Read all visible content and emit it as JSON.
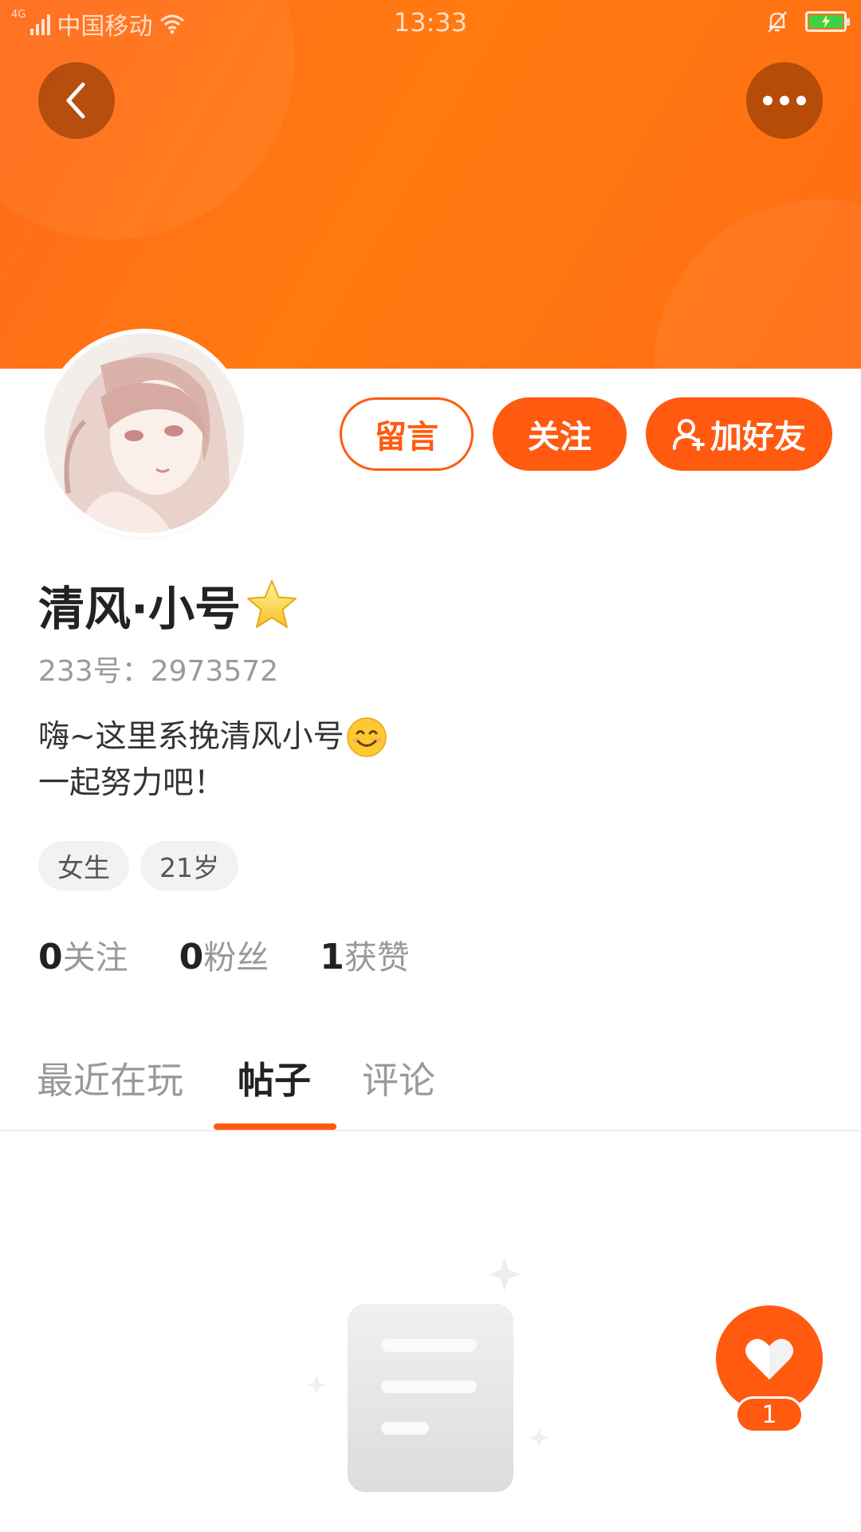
{
  "status_bar": {
    "network": "4G",
    "carrier": "中国移动",
    "time": "13:33",
    "battery_color": "#3bd24a"
  },
  "header": {
    "back_icon": "chevron-left-icon",
    "more_icon": "more-horizontal-icon"
  },
  "actions": {
    "message_label": "留言",
    "follow_label": "关注",
    "add_friend_label": "加好友",
    "accent_color": "#ff5a10"
  },
  "profile": {
    "name": "清风·小号",
    "name_badge_icon": "star-icon",
    "uid_label": "233号：",
    "uid_value": "2973572",
    "bio_line1": "嗨~这里系挽清风小号",
    "bio_emoji_icon": "smile-emoji-icon",
    "bio_line2": "一起努力吧！",
    "tags": [
      "女生",
      "21岁"
    ]
  },
  "stats": [
    {
      "count": "0",
      "label": "关注"
    },
    {
      "count": "0",
      "label": "粉丝"
    },
    {
      "count": "1",
      "label": "获赞"
    }
  ],
  "tabs": {
    "items": [
      "最近在玩",
      "帖子",
      "评论"
    ],
    "active": "帖子"
  },
  "like": {
    "count": "1",
    "icon": "heart-icon"
  }
}
